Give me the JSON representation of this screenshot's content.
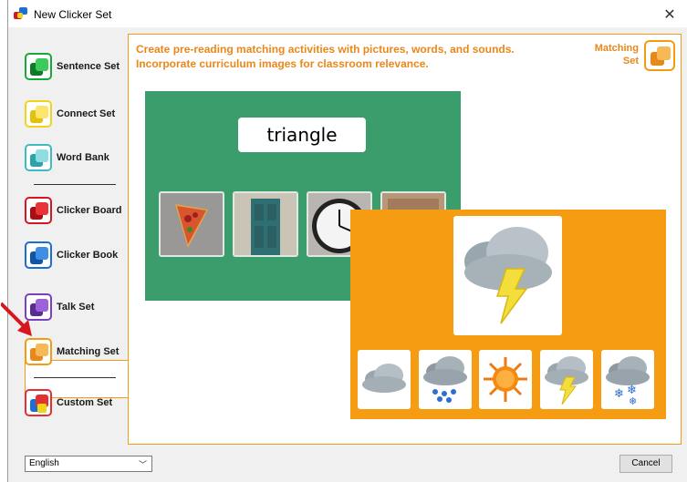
{
  "window": {
    "title": "New Clicker Set",
    "close_glyph": "✕"
  },
  "sidebar": {
    "items": [
      {
        "label": "Sentence Set",
        "icon": "sentence-set-icon",
        "color": "#18a93a"
      },
      {
        "label": "Connect Set",
        "icon": "connect-set-icon",
        "color": "#f0d419"
      },
      {
        "label": "Word Bank",
        "icon": "word-bank-icon",
        "color": "#3fbcc2"
      },
      {
        "label": "Clicker Board",
        "icon": "clicker-board-icon",
        "color": "#d7171f"
      },
      {
        "label": "Clicker Book",
        "icon": "clicker-book-icon",
        "color": "#1b6fd1"
      },
      {
        "label": "Talk Set",
        "icon": "talk-set-icon",
        "color": "#7b3fbf"
      },
      {
        "label": "Matching Set",
        "icon": "matching-set-icon",
        "color": "#f39c12",
        "active": true
      },
      {
        "label": "Custom Set",
        "icon": "custom-set-icon",
        "color": "#e33030"
      }
    ]
  },
  "content": {
    "description_line1": "Create pre-reading matching activities with pictures, words, and sounds.",
    "description_line2": "Incorporate curriculum images for classroom relevance.",
    "badge_line1": "Matching",
    "badge_line2": "Set",
    "preview": {
      "word": "triangle",
      "photos": [
        "pizza-slice-photo",
        "door-photo",
        "clock-photo",
        "wood-photo"
      ],
      "target_icon": "storm-cloud-icon",
      "choices": [
        "cloud-icon",
        "rain-cloud-icon",
        "sun-icon",
        "lightning-cloud-icon",
        "snow-cloud-icon"
      ]
    }
  },
  "footer": {
    "language": "English",
    "cancel_label": "Cancel"
  },
  "colors": {
    "accent": "#f39c12",
    "accent_text": "#e8881b",
    "green_panel": "#3c9d6c",
    "orange_panel": "#f59c12",
    "pointer_arrow": "#d7171f"
  }
}
